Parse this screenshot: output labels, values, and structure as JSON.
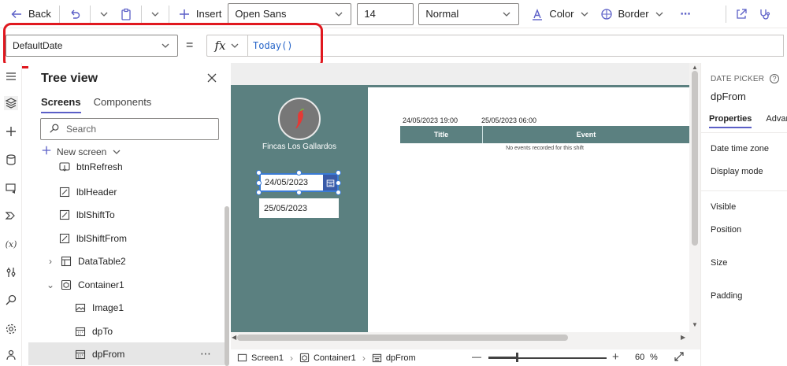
{
  "toolbar": {
    "back_label": "Back",
    "insert_label": "Insert",
    "font_value": "Open Sans",
    "size_value": "14",
    "weight_value": "Normal",
    "color_label": "Color",
    "border_label": "Border",
    "more_label": "⋯"
  },
  "formula": {
    "property_value": "DefaultDate",
    "equals": "=",
    "fx_label": "fx",
    "expression": "Today()"
  },
  "tree": {
    "title": "Tree view",
    "tabs": [
      "Screens",
      "Components"
    ],
    "search_placeholder": "Search",
    "new_screen_label": "New screen",
    "items": [
      {
        "label": "btnRefresh",
        "icon": "button-icon"
      },
      {
        "label": "lblHeader",
        "icon": "label-icon"
      },
      {
        "label": "lblShiftTo",
        "icon": "label-icon"
      },
      {
        "label": "lblShiftFrom",
        "icon": "label-icon"
      },
      {
        "label": "DataTable2",
        "icon": "table-icon"
      },
      {
        "label": "Container1",
        "icon": "container-icon"
      },
      {
        "label": "Image1",
        "icon": "image-icon"
      },
      {
        "label": "dpTo",
        "icon": "calendar-icon"
      },
      {
        "label": "dpFrom",
        "icon": "calendar-icon"
      }
    ],
    "selected_more": "⋯"
  },
  "canvas": {
    "company_name": "Fincas Los Gallardos",
    "date_from": "24/05/2023",
    "date_to": "25/05/2023",
    "shift_from": "24/05/2023 19:00",
    "shift_to": "25/05/2023 06:00",
    "table_columns": [
      "Title",
      "Event"
    ],
    "empty_message": "No events recorded for this shift",
    "accent_color": "#5b8080"
  },
  "status": {
    "crumbs": [
      "Screen1",
      "Container1",
      "dpFrom"
    ],
    "zoom_minus": "—",
    "zoom_plus": "+",
    "zoom_value": "60",
    "zoom_unit": "%",
    "zoom_fraction": 0.6
  },
  "properties": {
    "kind": "DATE PICKER",
    "name": "dpFrom",
    "tabs": [
      "Properties",
      "Advan"
    ],
    "rows": [
      "Date time zone",
      "Display mode",
      "Visible",
      "Position",
      "Size",
      "Padding"
    ]
  }
}
